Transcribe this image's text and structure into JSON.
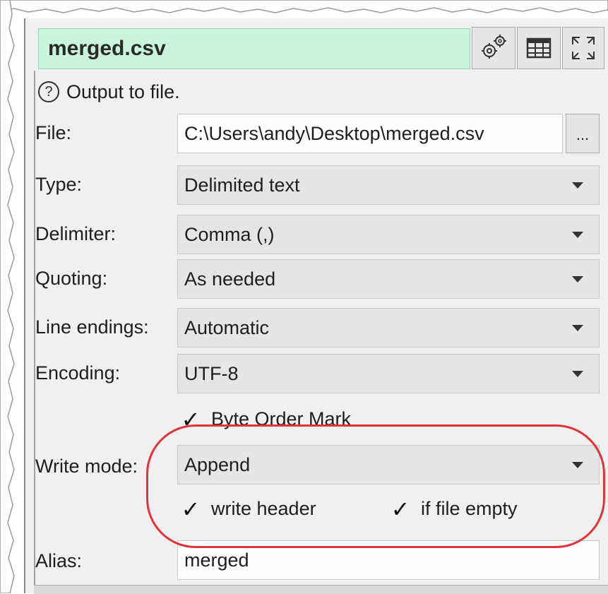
{
  "header": {
    "title": "merged.csv",
    "title_bg": "#c9f5df",
    "buttons": [
      {
        "icon": "gear-icon"
      },
      {
        "icon": "table-icon"
      },
      {
        "icon": "expand-icon"
      }
    ]
  },
  "help": {
    "icon": "question-circle-icon",
    "text": "Output to file."
  },
  "form": {
    "file": {
      "label": "File:",
      "value": "C:\\Users\\andy\\Desktop\\merged.csv",
      "browse_label": "..."
    },
    "type": {
      "label": "Type:",
      "value": "Delimited text"
    },
    "delimiter": {
      "label": "Delimiter:",
      "value": "Comma (,)"
    },
    "quoting": {
      "label": "Quoting:",
      "value": "As needed"
    },
    "line_endings": {
      "label": "Line endings:",
      "value": "Automatic"
    },
    "encoding": {
      "label": "Encoding:",
      "value": "UTF-8"
    },
    "bom": {
      "label": "Byte Order Mark",
      "checked": true
    },
    "write_mode": {
      "label": "Write mode:",
      "value": "Append"
    },
    "write_header": {
      "label": "write header",
      "checked": true
    },
    "if_file_empty": {
      "label": "if file empty",
      "checked": true
    },
    "alias": {
      "label": "Alias:",
      "value": "merged"
    }
  },
  "colors": {
    "highlight": "#e0343c",
    "accent_green": "#c9f5df"
  }
}
